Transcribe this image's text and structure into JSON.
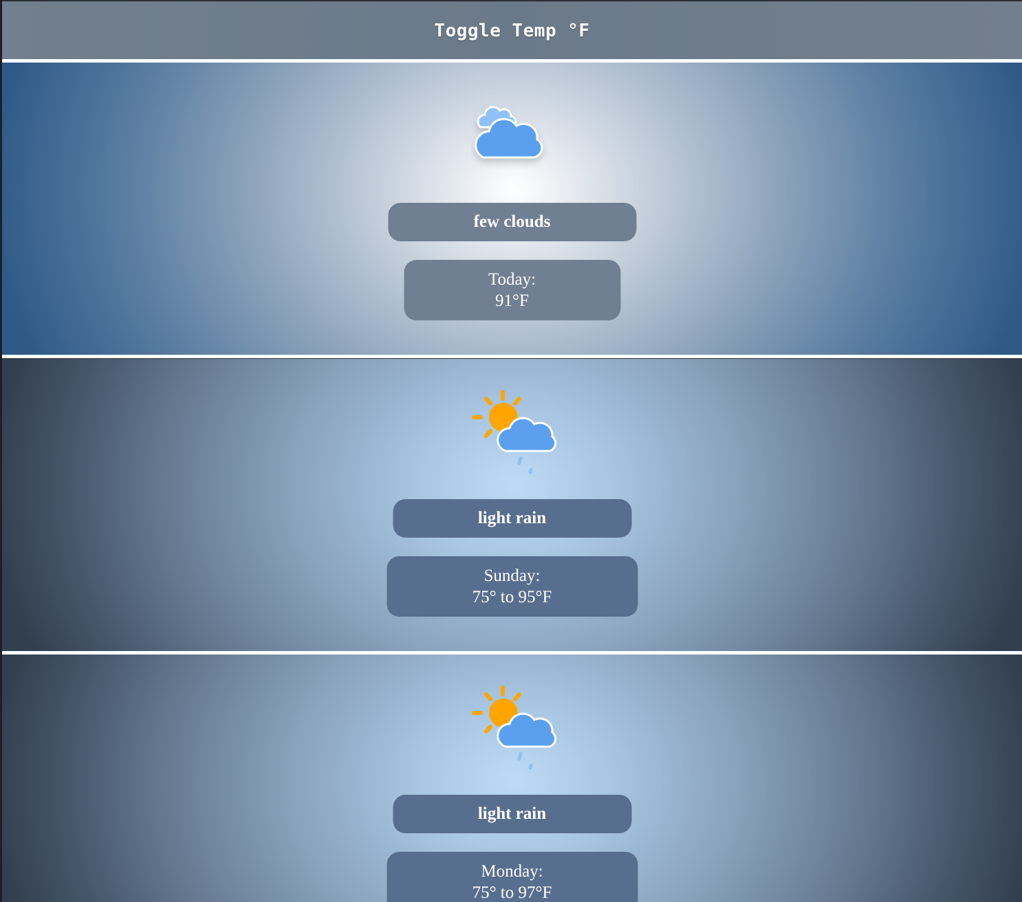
{
  "header": {
    "toggle_label": "Toggle Temp °F"
  },
  "cards": [
    {
      "icon": "few-clouds-icon",
      "description": "few clouds",
      "day_label": "Today:",
      "temperature": "91°F"
    },
    {
      "icon": "sun-cloud-rain-icon",
      "description": "light rain",
      "day_label": "Sunday:",
      "temperature": "75° to 95°F"
    },
    {
      "icon": "sun-cloud-rain-icon",
      "description": "light rain",
      "day_label": "Monday:",
      "temperature": "75° to 97°F"
    }
  ],
  "colors": {
    "cloud": "#5aa0ee",
    "cloud_light": "#8ec1f6",
    "sun": "#ffa500",
    "rain": "#8fc2f2",
    "pill_today": "#717f93",
    "pill_forecast": "#586e8e"
  }
}
